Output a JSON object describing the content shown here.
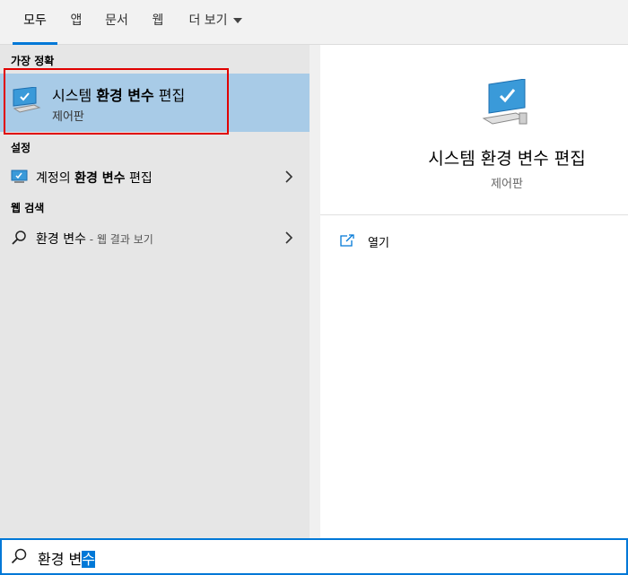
{
  "tabs": [
    {
      "label": "모두",
      "active": true
    },
    {
      "label": "앱"
    },
    {
      "label": "문서"
    },
    {
      "label": "웹"
    },
    {
      "label": "더 보기"
    }
  ],
  "best_match": {
    "section_title": "가장 정확",
    "title_parts": [
      "시스템 ",
      "환경 변수",
      " 편집"
    ],
    "subtitle": "제어판",
    "icon": "monitor-icon"
  },
  "settings": {
    "section_title": "설정",
    "item_parts": [
      "계정의 ",
      "환경 변수",
      " 편집"
    ],
    "icon": "display-settings-icon"
  },
  "web_search": {
    "section_title": "웹 검색",
    "query": "환경 변수",
    "suffix": " - 웹 결과 보기",
    "icon": "search-icon"
  },
  "detail": {
    "title": "시스템 환경 변수 편집",
    "subtitle": "제어판",
    "actions": [
      {
        "label": "열기",
        "icon": "open-icon"
      }
    ]
  },
  "search": {
    "text_before": "환경 변",
    "text_selected": "수",
    "icon": "search-icon"
  },
  "colors": {
    "accent": "#0078d7",
    "highlight": "#a8cbe7",
    "annotation": "#e00000"
  }
}
